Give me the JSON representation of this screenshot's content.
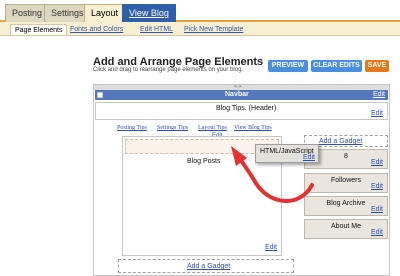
{
  "tabs": [
    {
      "label": "Posting"
    },
    {
      "label": "Settings"
    },
    {
      "label": "Layout"
    },
    {
      "label": "View Blog"
    }
  ],
  "subnav": [
    {
      "label": "Page Elements"
    },
    {
      "label": "Fonts and Colors"
    },
    {
      "label": "Edit HTML"
    },
    {
      "label": "Pick New Template"
    }
  ],
  "page": {
    "title": "Add and Arrange Page Elements",
    "subtitle": "Click and drag to rearrange page elements on your blog."
  },
  "buttons": {
    "preview": "PREVIEW",
    "clear": "CLEAR EDITS",
    "save": "SAVE"
  },
  "layout": {
    "drag_hint": "<->",
    "navbar": {
      "label": "Navbar",
      "edit": "Edit"
    },
    "header": {
      "label": "Blog Tips. (Header)",
      "edit": "Edit"
    },
    "pages": [
      "Posting Tips",
      "Settings Tips",
      "Layout Tips",
      "View Blog Tips"
    ],
    "pages_edit": "Edit",
    "add_gadget_top": "Add a Gadget",
    "floating_widget": {
      "label": "HTML/JavaScript",
      "edit": "Edit"
    },
    "main": {
      "label": "Blog Posts",
      "edit": "Edit"
    },
    "sidebar": [
      {
        "label": "8",
        "edit": "Edit"
      },
      {
        "label": "Followers",
        "edit": "Edit"
      },
      {
        "label": "Blog Archive",
        "edit": "Edit"
      },
      {
        "label": "About Me",
        "edit": "Edit"
      }
    ],
    "add_gadget_bottom": "Add a Gadget"
  },
  "colors": {
    "accent": "#e6a23a",
    "button_blue": "#4a8ee0",
    "button_orange": "#e87a1c",
    "navbar": "#5577bb",
    "arrow": "#e53030"
  }
}
